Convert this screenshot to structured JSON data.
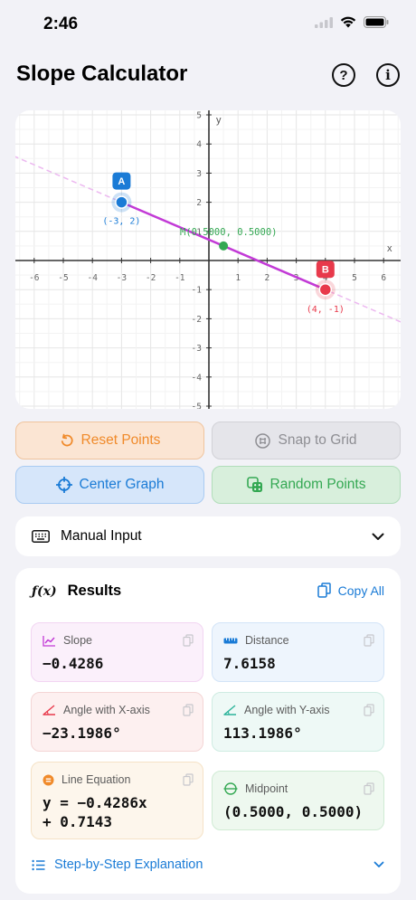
{
  "status": {
    "time": "2:46"
  },
  "nav": {
    "title": "Slope Calculator",
    "help_icon": "question-circle-icon",
    "info_icon": "info-circle-icon"
  },
  "graph": {
    "x_axis_label": "x",
    "y_axis_label": "y",
    "x_ticks": [
      "-6",
      "-5",
      "-4",
      "-3",
      "-2",
      "-1",
      "1",
      "2",
      "3",
      "4",
      "5",
      "6"
    ],
    "y_ticks": [
      "5",
      "4",
      "3",
      "2",
      "1",
      "-1",
      "-2",
      "-3",
      "-4",
      "-5"
    ],
    "point_a": {
      "label": "A",
      "coords": "(-3, 2)",
      "x": -3,
      "y": 2,
      "color": "#1a7bd6"
    },
    "point_b": {
      "label": "B",
      "coords": "(4, -1)",
      "x": 4,
      "y": -1,
      "color": "#e8394b"
    },
    "midpoint": {
      "label": "M(0.5000, 0.5000)",
      "x": 0.5,
      "y": 0.5,
      "color": "#34a853"
    },
    "segment_color": "#c23ad6",
    "extension_color": "#ecb8f0"
  },
  "buttons": {
    "reset": "Reset Points",
    "snap": "Snap to Grid",
    "center": "Center Graph",
    "random": "Random Points"
  },
  "manual_input": {
    "label": "Manual Input"
  },
  "results": {
    "title": "Results",
    "copy_all": "Copy All",
    "slope": {
      "label": "Slope",
      "value": "−0.4286"
    },
    "distance": {
      "label": "Distance",
      "value": "7.6158"
    },
    "angle_x": {
      "label": "Angle with X-axis",
      "value": "−23.1986°"
    },
    "angle_y": {
      "label": "Angle with Y-axis",
      "value": "113.1986°"
    },
    "equation": {
      "label": "Line Equation",
      "value_line1": "y = −0.4286x",
      "value_line2": "+ 0.7143"
    },
    "midpoint": {
      "label": "Midpoint",
      "value": "(0.5000, 0.5000)"
    },
    "steps": "Step-by-Step Explanation"
  },
  "colors": {
    "accent_blue": "#1a7bd6",
    "orange": "#f08a2a",
    "green": "#34a853",
    "red": "#e8394b",
    "purple": "#c23ad6"
  }
}
